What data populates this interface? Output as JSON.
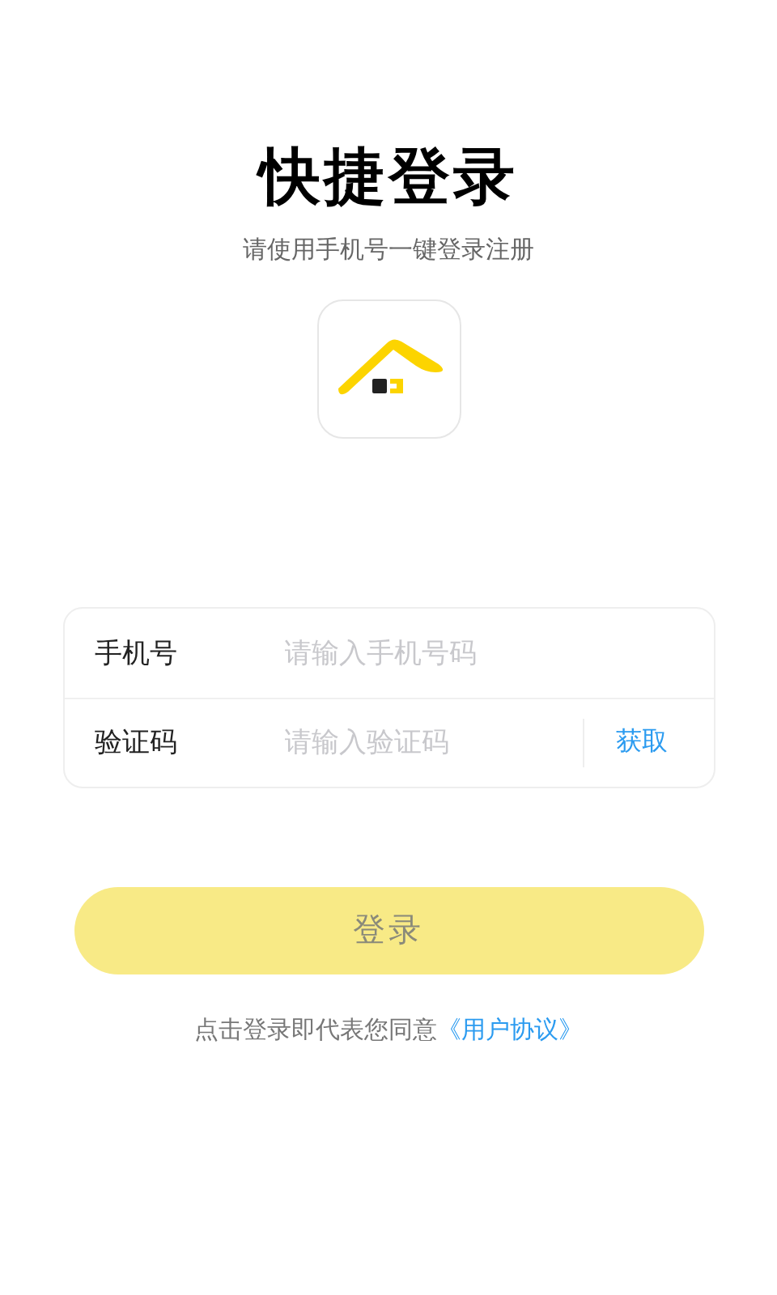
{
  "title": "快捷登录",
  "subtitle": "请使用手机号一键登录注册",
  "form": {
    "rows": [
      {
        "label": "手机号",
        "placeholder": "请输入手机号码"
      },
      {
        "label": "验证码",
        "placeholder": "请输入验证码",
        "action": "获取"
      }
    ]
  },
  "login_button": {
    "label": "登录",
    "disabled": true
  },
  "agreement": {
    "text": "点击登录即代表您同意",
    "link": "《用户协议》"
  }
}
